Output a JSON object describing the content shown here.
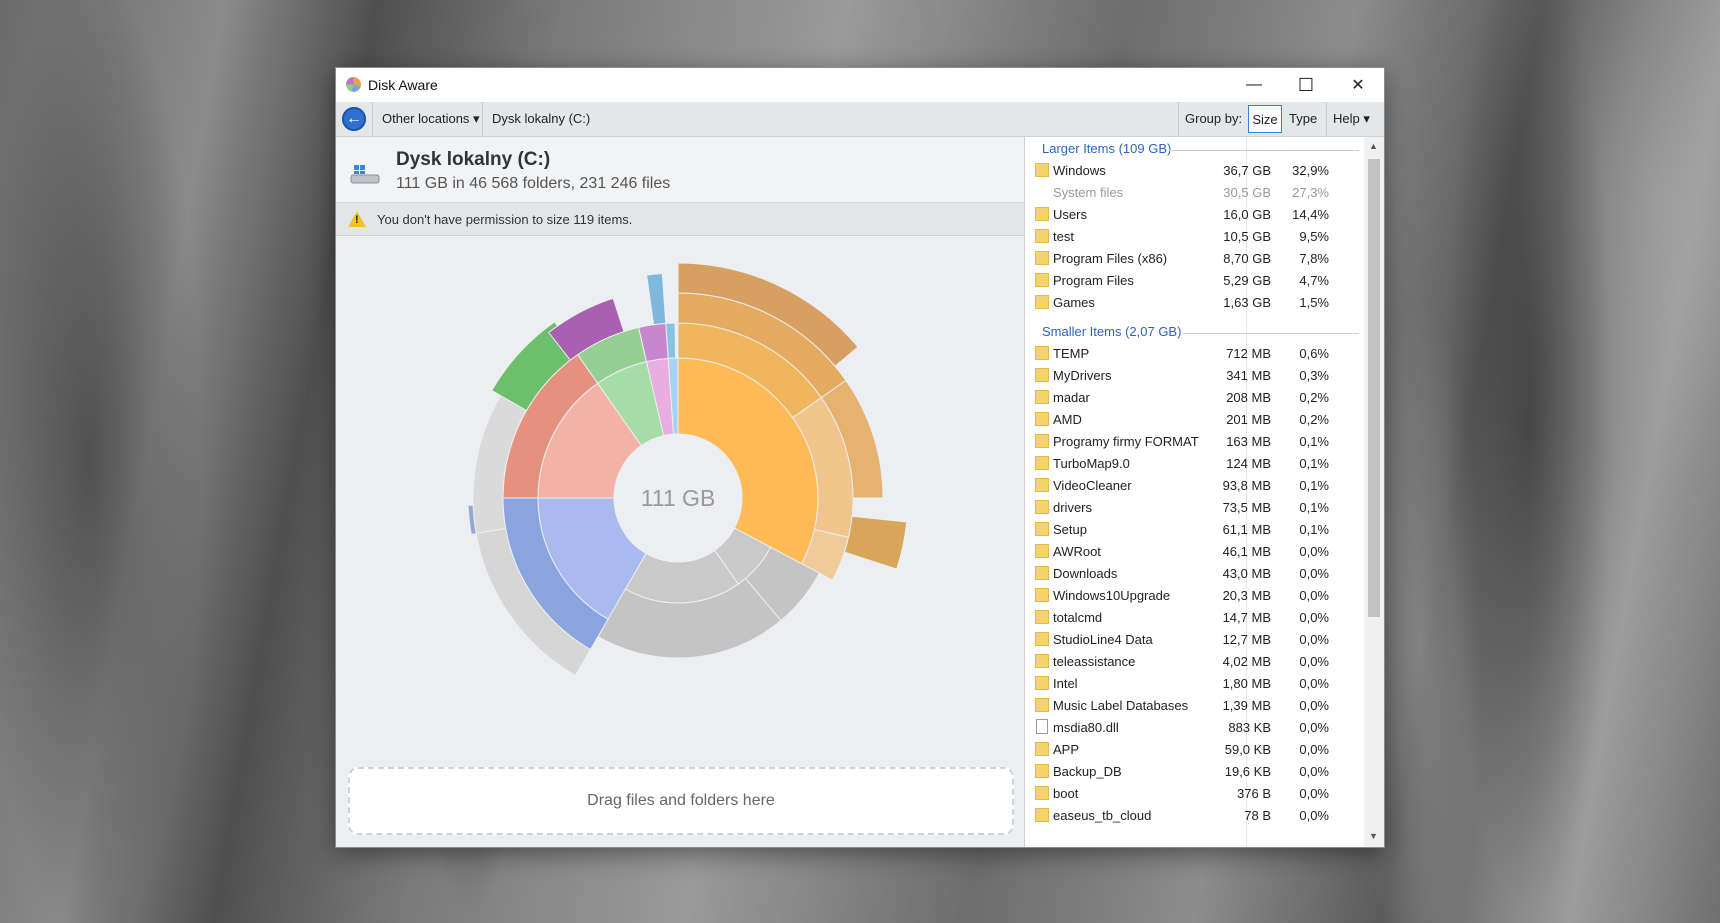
{
  "window": {
    "title": "Disk Aware",
    "controls": {
      "minimize": "—",
      "maximize": "☐",
      "close": "✕"
    }
  },
  "toolbar": {
    "location_menu": "Other locations ▾",
    "breadcrumb": "Dysk lokalny (C:)",
    "group_by_label": "Group by:",
    "size_option": "Size",
    "type_option": "Type",
    "help_menu": "Help ▾"
  },
  "drive": {
    "title": "Dysk lokalny (C:)",
    "summary": "111 GB in 46 568 folders, 231 246 files"
  },
  "warning": {
    "text": "You don't have permission to size 119 items."
  },
  "chart_data": {
    "type": "sunburst",
    "center_label": "111 GB",
    "note": "segments approximate folder share of total size"
  },
  "dropzone": {
    "text": "Drag files and folders here"
  },
  "list": {
    "larger_header": "Larger Items (109 GB)",
    "smaller_header": "Smaller Items (2,07 GB)",
    "larger": [
      {
        "name": "Windows",
        "size": "36,7 GB",
        "pct": "32,9%",
        "type": "folder"
      },
      {
        "name": "System files",
        "size": "30,5 GB",
        "pct": "27,3%",
        "type": "none",
        "muted": true
      },
      {
        "name": "Users",
        "size": "16,0 GB",
        "pct": "14,4%",
        "type": "folder"
      },
      {
        "name": "test",
        "size": "10,5 GB",
        "pct": "9,5%",
        "type": "folder"
      },
      {
        "name": "Program Files (x86)",
        "size": "8,70 GB",
        "pct": "7,8%",
        "type": "folder"
      },
      {
        "name": "Program Files",
        "size": "5,29 GB",
        "pct": "4,7%",
        "type": "folder"
      },
      {
        "name": "Games",
        "size": "1,63 GB",
        "pct": "1,5%",
        "type": "folder"
      }
    ],
    "smaller": [
      {
        "name": "TEMP",
        "size": "712 MB",
        "pct": "0,6%",
        "type": "folder"
      },
      {
        "name": "MyDrivers",
        "size": "341 MB",
        "pct": "0,3%",
        "type": "folder"
      },
      {
        "name": "madar",
        "size": "208 MB",
        "pct": "0,2%",
        "type": "folder"
      },
      {
        "name": "AMD",
        "size": "201 MB",
        "pct": "0,2%",
        "type": "folder"
      },
      {
        "name": "Programy firmy FORMAT",
        "size": "163 MB",
        "pct": "0,1%",
        "type": "folder"
      },
      {
        "name": "TurboMap9.0",
        "size": "124 MB",
        "pct": "0,1%",
        "type": "folder"
      },
      {
        "name": "VideoCleaner",
        "size": "93,8 MB",
        "pct": "0,1%",
        "type": "folder"
      },
      {
        "name": "drivers",
        "size": "73,5 MB",
        "pct": "0,1%",
        "type": "folder"
      },
      {
        "name": "Setup",
        "size": "61,1 MB",
        "pct": "0,1%",
        "type": "folder"
      },
      {
        "name": "AWRoot",
        "size": "46,1 MB",
        "pct": "0,0%",
        "type": "folder"
      },
      {
        "name": "Downloads",
        "size": "43,0 MB",
        "pct": "0,0%",
        "type": "folder"
      },
      {
        "name": "Windows10Upgrade",
        "size": "20,3 MB",
        "pct": "0,0%",
        "type": "folder"
      },
      {
        "name": "totalcmd",
        "size": "14,7 MB",
        "pct": "0,0%",
        "type": "folder"
      },
      {
        "name": "StudioLine4 Data",
        "size": "12,7 MB",
        "pct": "0,0%",
        "type": "folder"
      },
      {
        "name": "teleassistance",
        "size": "4,02 MB",
        "pct": "0,0%",
        "type": "folder"
      },
      {
        "name": "Intel",
        "size": "1,80 MB",
        "pct": "0,0%",
        "type": "folder"
      },
      {
        "name": "Music Label Databases",
        "size": "1,39 MB",
        "pct": "0,0%",
        "type": "folder"
      },
      {
        "name": "msdia80.dll",
        "size": "883 KB",
        "pct": "0,0%",
        "type": "file"
      },
      {
        "name": "APP",
        "size": "59,0 KB",
        "pct": "0,0%",
        "type": "folder"
      },
      {
        "name": "Backup_DB",
        "size": "19,6 KB",
        "pct": "0,0%",
        "type": "folder"
      },
      {
        "name": "boot",
        "size": "376 B",
        "pct": "0,0%",
        "type": "folder"
      },
      {
        "name": "easeus_tb_cloud",
        "size": "78 B",
        "pct": "0,0%",
        "type": "folder"
      }
    ]
  }
}
